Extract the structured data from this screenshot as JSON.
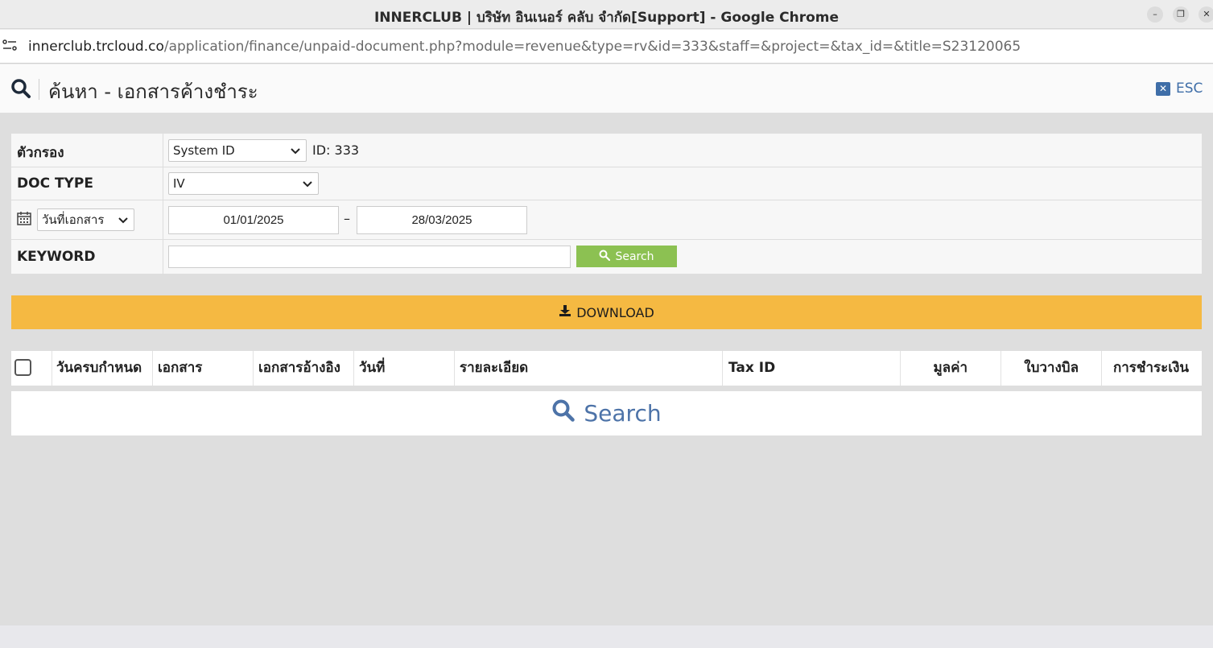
{
  "window": {
    "title": "INNERCLUB | บริษัท อินเนอร์ คลับ จำกัด[Support] - Google Chrome",
    "minimize_label": "–",
    "maximize_label": "❐",
    "close_label": "✕"
  },
  "address_bar": {
    "domain": "innerclub.trcloud.co",
    "path": "/application/finance/unpaid-document.php?module=revenue&type=rv&id=333&staff=&project=&tax_id=&title=S23120065"
  },
  "header": {
    "title": "ค้นหา - เอกสารค้างชำระ",
    "esc_label": "ESC"
  },
  "filters": {
    "filter_label": "ตัวกรอง",
    "filter_select_value": "System ID",
    "filter_id_text": "ID: 333",
    "doc_type_label": "DOC TYPE",
    "doc_type_value": "IV",
    "date_type_value": "วันที่เอกสาร",
    "date_from": "01/01/2025",
    "date_separator": "–",
    "date_to": "28/03/2025",
    "keyword_label": "KEYWORD",
    "keyword_value": "",
    "search_button_label": "Search"
  },
  "download": {
    "label": "DOWNLOAD"
  },
  "table": {
    "columns": [
      "วันครบกำหนด",
      "เอกสาร",
      "เอกสารอ้างอิง",
      "วันที่",
      "รายละเอียด",
      "Tax ID",
      "มูลค่า",
      "ใบวางบิล",
      "การชำระเงิน"
    ],
    "empty_label": "Search"
  },
  "colors": {
    "accent_blue": "#4d73a8",
    "search_green": "#8cc152",
    "download_yellow": "#f5b942"
  }
}
